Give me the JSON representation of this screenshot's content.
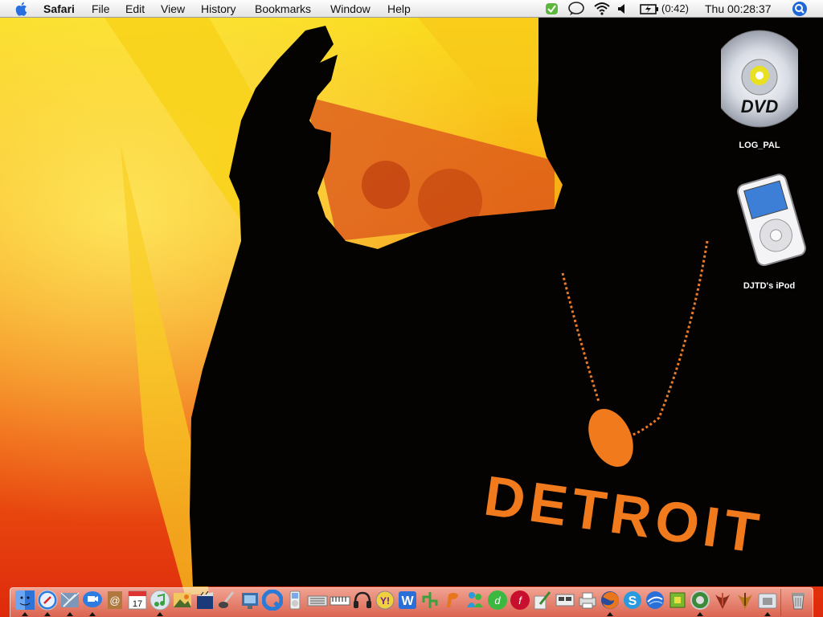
{
  "menubar": {
    "app_name": "Safari",
    "menus": [
      "File",
      "Edit",
      "View",
      "History",
      "Bookmarks",
      "Window",
      "Help"
    ],
    "battery_time": "(0:42)",
    "clock": "Thu 00:28:37"
  },
  "desktop": {
    "icons": [
      {
        "label": "LOG_PAL",
        "icon": "dvd-disc-icon"
      },
      {
        "label": "DJTD's iPod",
        "icon": "ipod-icon"
      }
    ],
    "wallpaper_text": "DETROIT"
  },
  "dock": {
    "apps": [
      "finder-icon",
      "safari-icon",
      "mail-icon",
      "ichat-icon",
      "address-book-icon",
      "ical-icon",
      "itunes-icon",
      "iphoto-icon",
      "imovie-icon",
      "garageband-icon",
      "preview-icon",
      "quicktime-icon",
      "ipod-updater-icon",
      "keyboard-icon",
      "keyboard2-icon",
      "headphones-icon",
      "yahoo-widget-icon",
      "word-icon",
      "tree-icon",
      "paint-icon",
      "messenger-icon",
      "dreamweaver-icon",
      "flash-icon",
      "pen-tool-icon",
      "network-icon",
      "printer-icon",
      "firefox-icon",
      "skype-icon",
      "globe-icon",
      "chip-icon",
      "settings-icon",
      "quake-icon",
      "quake2-icon",
      "folder-icon",
      "trash-icon"
    ]
  },
  "colors": {
    "wallpaper_yellow": "#f8d21a",
    "wallpaper_orange": "#f07a12",
    "wallpaper_red": "#e2300d",
    "silhouette": "#050302",
    "shirt_text": "#f07a1c"
  }
}
